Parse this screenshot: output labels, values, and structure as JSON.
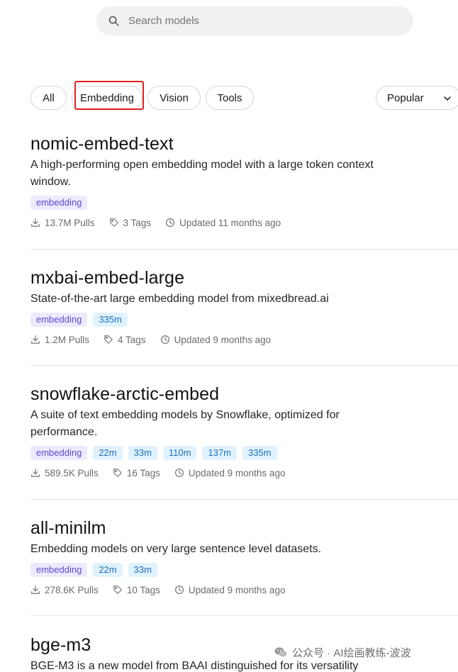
{
  "search": {
    "placeholder": "Search models"
  },
  "filters": {
    "chips": [
      "All",
      "Embedding",
      "Vision",
      "Tools"
    ],
    "sort": "Popular"
  },
  "models": [
    {
      "name": "nomic-embed-text",
      "description": "A high-performing open embedding model with a large token context window.",
      "tags": [
        {
          "label": "embedding",
          "kind": "capability"
        }
      ],
      "pulls": "13.7M Pulls",
      "tags_count": "3 Tags",
      "updated": "Updated 11 months ago"
    },
    {
      "name": "mxbai-embed-large",
      "description": "State-of-the-art large embedding model from mixedbread.ai",
      "tags": [
        {
          "label": "embedding",
          "kind": "capability"
        },
        {
          "label": "335m",
          "kind": "size"
        }
      ],
      "pulls": "1.2M Pulls",
      "tags_count": "4 Tags",
      "updated": "Updated 9 months ago"
    },
    {
      "name": "snowflake-arctic-embed",
      "description": "A suite of text embedding models by Snowflake, optimized for performance.",
      "tags": [
        {
          "label": "embedding",
          "kind": "capability"
        },
        {
          "label": "22m",
          "kind": "size"
        },
        {
          "label": "33m",
          "kind": "size"
        },
        {
          "label": "110m",
          "kind": "size"
        },
        {
          "label": "137m",
          "kind": "size"
        },
        {
          "label": "335m",
          "kind": "size"
        }
      ],
      "pulls": "589.5K Pulls",
      "tags_count": "16 Tags",
      "updated": "Updated 9 months ago"
    },
    {
      "name": "all-minilm",
      "description": "Embedding models on very large sentence level datasets.",
      "tags": [
        {
          "label": "embedding",
          "kind": "capability"
        },
        {
          "label": "22m",
          "kind": "size"
        },
        {
          "label": "33m",
          "kind": "size"
        }
      ],
      "pulls": "278.6K Pulls",
      "tags_count": "10 Tags",
      "updated": "Updated 9 months ago"
    },
    {
      "name": "bge-m3",
      "description": "BGE-M3 is a new model from BAAI distinguished for its versatility",
      "tags": [],
      "pulls": "",
      "tags_count": "",
      "updated": ""
    }
  ],
  "watermark": "公众号 · AI绘画教练-波波",
  "colors": {
    "capability_bg": "#ede9fe",
    "capability_fg": "#5b4bd1",
    "size_bg": "#e0f2fe",
    "size_fg": "#1d6fb8",
    "highlight": "#e02020"
  }
}
